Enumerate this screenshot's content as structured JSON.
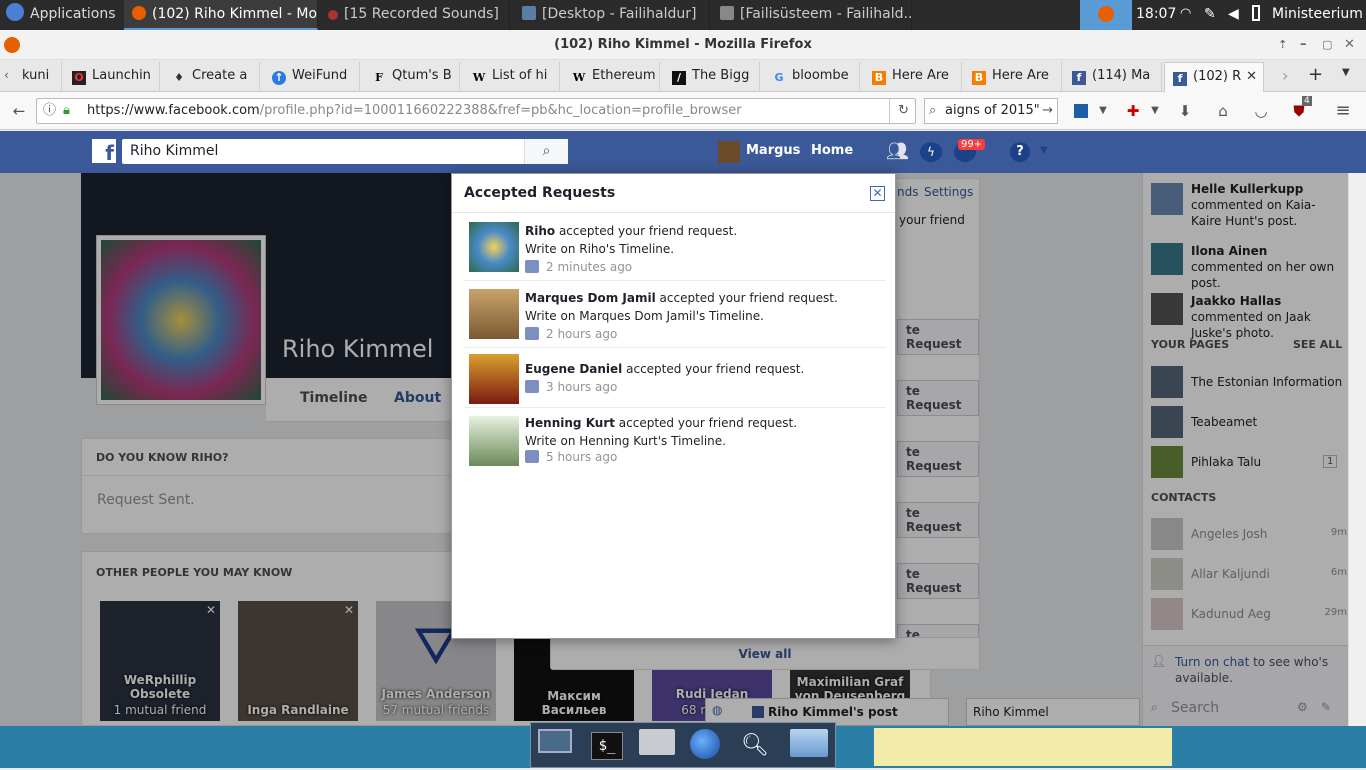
{
  "panel": {
    "apps_label": "Applications",
    "tasks": [
      "(102) Riho Kimmel - Mo...",
      "[15 Recorded Sounds]",
      "[Desktop - Failihaldur]",
      "[Failisüsteem - Failihald..."
    ],
    "clock": "18:07",
    "user": "Ministeerium"
  },
  "firefox": {
    "window_title": "(102) Riho Kimmel - Mozilla Firefox",
    "tabs": [
      "kuni",
      "Launchin",
      "Create a",
      "WeiFund",
      "Qtum's B",
      "List of hi",
      "Ethereum",
      "The Bigg",
      "bloombe",
      "Here Are",
      "Here Are",
      "(114) Ma",
      "(102) R"
    ],
    "url_host": "https://www.facebook.com",
    "url_path": "/profile.php?id=100011660222388&fref=pb&hc_location=profile_browser",
    "search_value": "aigns of 2015\"",
    "badge_count": "4"
  },
  "facebook": {
    "search_value": "Riho Kimmel",
    "user_name": "Margus",
    "home_label": "Home",
    "notif_count": "99+",
    "profile_name": "Riho Kimmel",
    "timeline_tab": "Timeline",
    "about_tab": "About",
    "do_you_know": "DO YOU KNOW RIHO?",
    "request_sent": "Request Sent.",
    "other_people": "OTHER PEOPLE YOU MAY KNOW",
    "people": [
      {
        "name": "WeRphillip Obsolete",
        "mutual": "1 mutual friend"
      },
      {
        "name": "Inga Randlaine",
        "mutual": ""
      },
      {
        "name": "James Anderson",
        "mutual": "57 mutual friends"
      },
      {
        "name": "Максим Васильев",
        "mutual": ""
      },
      {
        "name": "Rudi Jedan",
        "mutual": "68 mutual"
      },
      {
        "name": "Maximilian Graf von Deusenberg",
        "mutual": ""
      }
    ],
    "bg_links": {
      "friends": "nds",
      "settings": "Settings",
      "your_friend": "your friend",
      "request_btn": "te Request",
      "view_all": "View all"
    },
    "chat_tabs": {
      "post": "Riho Kimmel's post",
      "person": "Riho Kimmel"
    }
  },
  "dialog": {
    "title": "Accepted Requests",
    "requests": [
      {
        "name": "Riho",
        "action": " accepted your friend request.",
        "write": "Write on Riho's Timeline.",
        "time": "2 minutes ago"
      },
      {
        "name": "Marques Dom Jamil",
        "action": " accepted your friend request.",
        "write": "Write on Marques Dom Jamil's Timeline.",
        "time": "2 hours ago"
      },
      {
        "name": "Eugene Daniel",
        "action": " accepted your friend request.",
        "write": "",
        "time": "3 hours ago"
      },
      {
        "name": "Henning Kurt",
        "action": " accepted your friend request.",
        "write": "Write on Henning Kurt's Timeline.",
        "time": "5 hours ago"
      }
    ]
  },
  "rightcol": {
    "ticker": [
      {
        "name": "Helle Kullerkupp",
        "text": " commented on Kaia-Kaire Hunt's post."
      },
      {
        "name": "Ilona Ainen",
        "text": " commented on her own post."
      },
      {
        "name": "Jaakko Hallas",
        "text": " commented on Jaak Juske's photo."
      }
    ],
    "your_pages": "YOUR PAGES",
    "see_all": "SEE ALL",
    "pages": [
      {
        "name": "The Estonian Information ...",
        "count": ""
      },
      {
        "name": "Teabeamet",
        "count": ""
      },
      {
        "name": "Pihlaka Talu",
        "count": "1"
      }
    ],
    "contacts_label": "CONTACTS",
    "contacts": [
      {
        "name": "Angeles Josh",
        "time": "9m"
      },
      {
        "name": "Allar Kaljundi",
        "time": "6m"
      },
      {
        "name": "Kadunud Aeg",
        "time": "29m"
      }
    ],
    "chat_link": "Turn on chat",
    "chat_text": " to see who's available.",
    "search_placeholder": "Search"
  },
  "colors": {
    "fb_blue": "#3b5998",
    "panel": "#2b2b2b",
    "notif_red": "#fa3e3e"
  }
}
